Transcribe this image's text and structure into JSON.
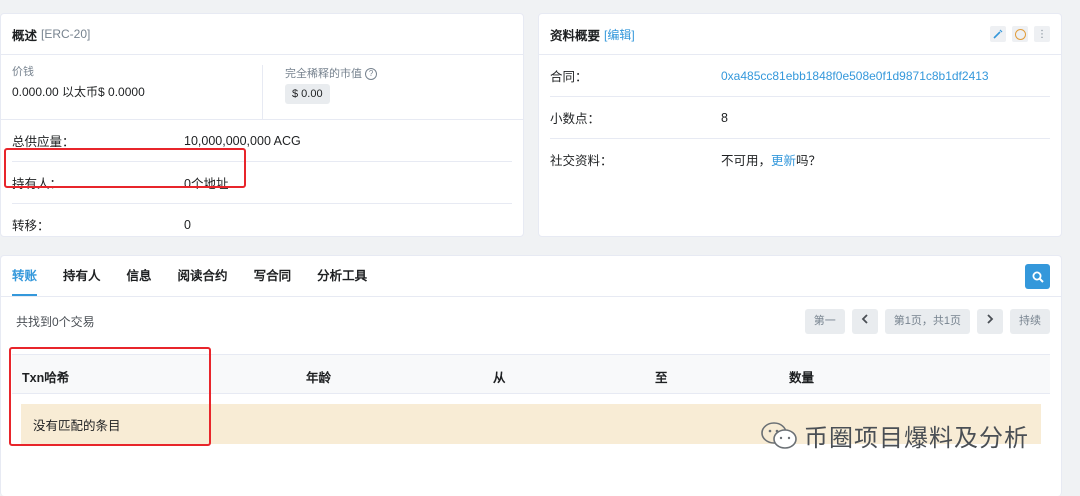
{
  "overview": {
    "title": "概述",
    "subtitle": "[ERC-20]",
    "price_label": "价钱",
    "price_value": "0.000.00 以太币$ 0.0000",
    "market_cap_label": "完全稀释的市值",
    "market_cap_value": "$ 0.00",
    "rows": [
      {
        "label": "总供应量：",
        "value": "10,000,000,000 ACG"
      },
      {
        "label": "持有人：",
        "value": "0个地址"
      },
      {
        "label": "转移：",
        "value": "0"
      }
    ]
  },
  "profile": {
    "title": "资料概要",
    "edit_label": "[编辑]",
    "contract_label": "合同：",
    "contract_value": "0xa485cc81ebb1848f0e508e0f1d9871c8b1df2413",
    "decimals_label": "小数点：",
    "decimals_value": "8",
    "social_label": "社交资料：",
    "social_prefix": "不可用，",
    "social_link": "更新",
    "social_suffix": "吗？"
  },
  "tabs": [
    {
      "label": "转账",
      "active": true
    },
    {
      "label": "持有人"
    },
    {
      "label": "信息"
    },
    {
      "label": "阅读合约"
    },
    {
      "label": "写合同"
    },
    {
      "label": "分析工具"
    }
  ],
  "results_text": "共找到0个交易",
  "pager": {
    "first": "第一",
    "page_info": "第1页，共1页",
    "last": "持续"
  },
  "table": {
    "headers": [
      "Txn哈希",
      "年龄",
      "从",
      "至",
      "数量"
    ],
    "empty_text": "没有匹配的条目"
  },
  "watermark": "币圈项目爆料及分析",
  "colors": {
    "accent": "#3498db",
    "highlight": "#e8252b",
    "empty_row": "#f8ecd5"
  }
}
